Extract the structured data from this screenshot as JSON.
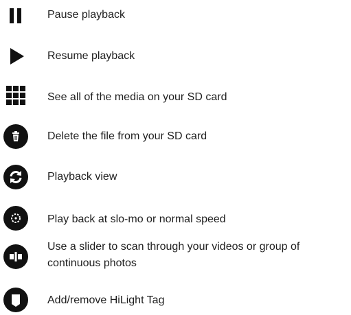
{
  "items": [
    {
      "icon": "pause-icon",
      "label": "Pause playback"
    },
    {
      "icon": "play-icon",
      "label": "Resume playback"
    },
    {
      "icon": "grid-icon",
      "label": "See all of the media on your SD card"
    },
    {
      "icon": "trash-icon",
      "label": "Delete the file from your SD card"
    },
    {
      "icon": "refresh-icon",
      "label": "Playback view"
    },
    {
      "icon": "slow-motion-icon",
      "label": "Play back at slo-mo or normal speed"
    },
    {
      "icon": "slider-icon",
      "label": "Use a slider to scan through your videos or group of continuous photos"
    },
    {
      "icon": "hilight-tag-icon",
      "label": "Add/remove HiLight Tag"
    }
  ],
  "colors": {
    "icon": "#111111",
    "text": "#1e1e1e",
    "background": "#ffffff"
  }
}
